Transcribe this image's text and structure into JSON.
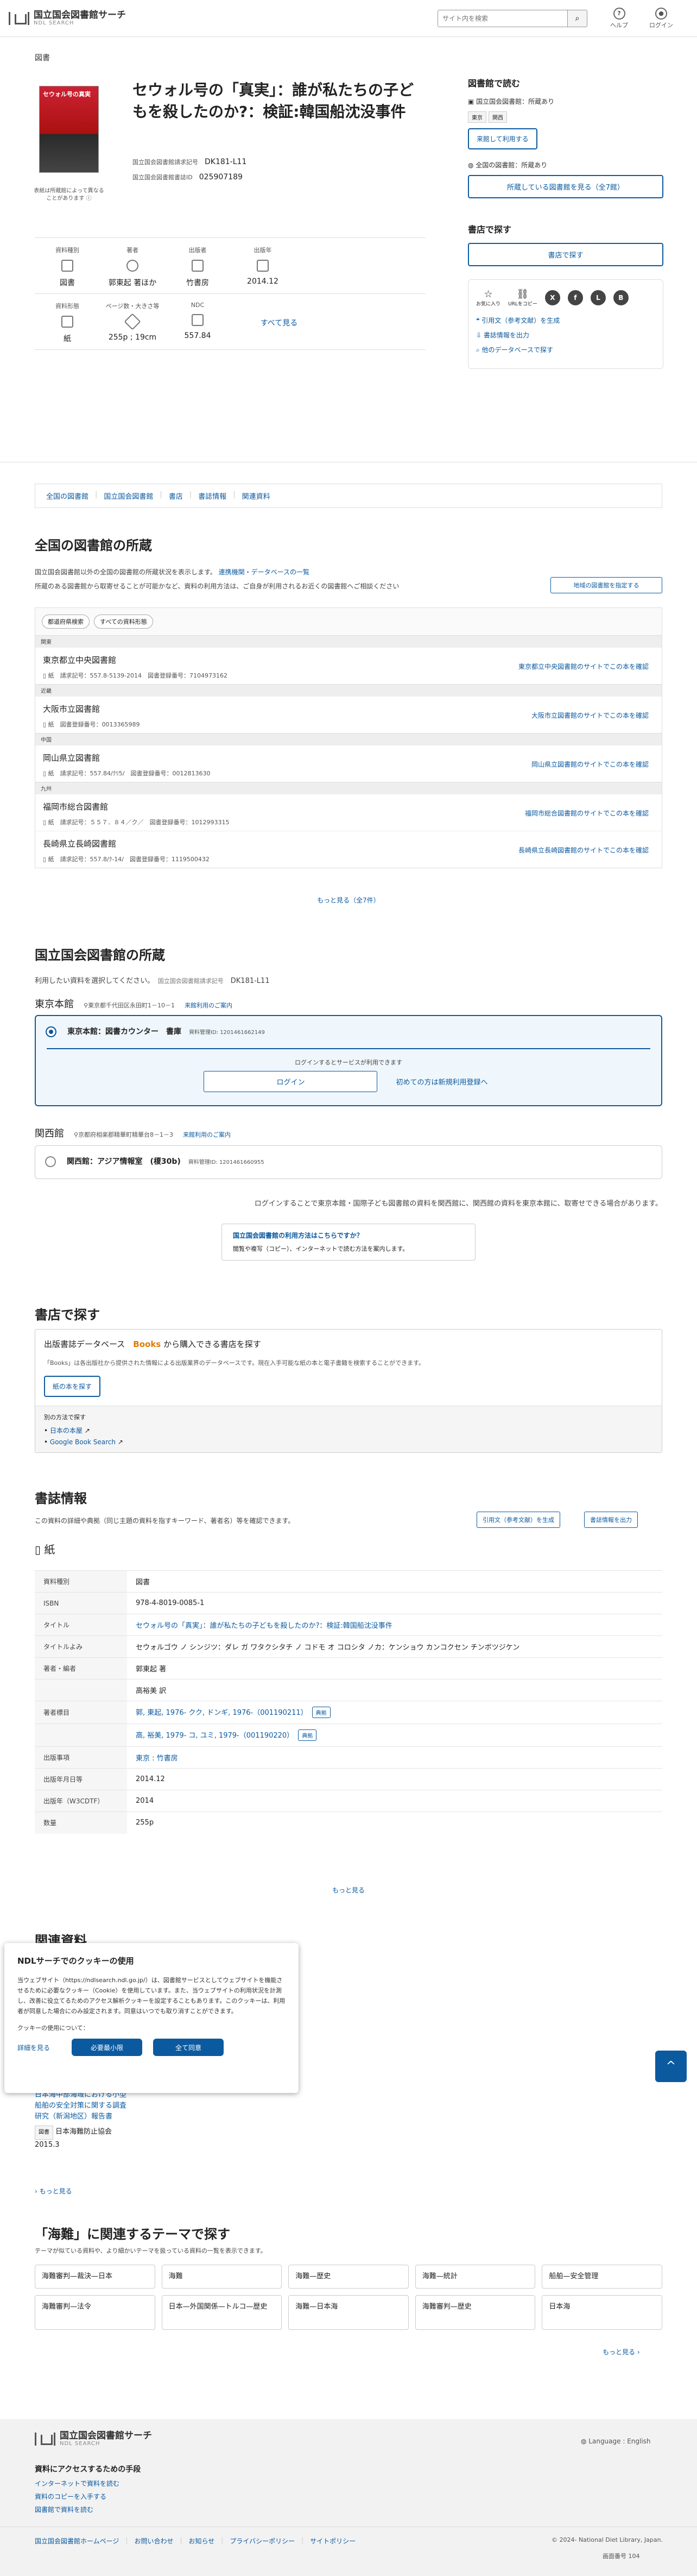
{
  "header": {
    "logo_title": "国立国会図書館サーチ",
    "logo_sub": "NDL SEARCH",
    "search_placeholder": "サイト内を検索",
    "help": "ヘルプ",
    "login": "ログイン"
  },
  "page_label": "図書",
  "book": {
    "title": "セウォル号の「真実」：誰が私たちの子どもを殺したのか?：検証:韓国船沈没事件",
    "cover_title": "セウォル号の真実",
    "cover_note": "表紙は所蔵館によって異なることがあります",
    "call_label": "国立国会図書館請求記号",
    "call_no": "DK181-L11",
    "bib_label": "国立国会図書館書誌ID",
    "bib_id": "025907189"
  },
  "meta": [
    {
      "label": "資料種別",
      "value": "図書"
    },
    {
      "label": "著者",
      "value": "郭東起 著ほか"
    },
    {
      "label": "出版者",
      "value": "竹書房"
    },
    {
      "label": "出版年",
      "value": "2014.12"
    },
    {
      "label": "資料形態",
      "value": "紙"
    },
    {
      "label": "ページ数・大きさ等",
      "value": "255p ; 19cm"
    },
    {
      "label": "NDC",
      "value": "557.84"
    }
  ],
  "meta_more": "すべて見る",
  "side": {
    "read_title": "図書館で読む",
    "ndl_owned": "国立国会図書館：所蔵あり",
    "tag1": "東京",
    "tag2": "関西",
    "visit_btn": "来館して利用する",
    "all_owned": "全国の図書館：所蔵あり",
    "all_btn": "所蔵している図書館を見る（全7館）",
    "shop_title": "書店で探す",
    "shop_btn": "書店で探す",
    "share_label1": "お気に入り",
    "share_label2": "URLをコピー",
    "cite": "引用文（参考文献）を生成",
    "export": "書誌情報を出力",
    "other_db": "他のデータベースで探す"
  },
  "tabs": [
    "全国の図書館",
    "国立国会図書館",
    "書店",
    "書誌情報",
    "関連資料"
  ],
  "national": {
    "heading": "全国の図書館の所蔵",
    "desc1": "国立国会図書館以外の全国の図書館の所蔵状況を表示します。",
    "db_link": "連携機関・データベースの一覧",
    "desc2": "所蔵のある図書館から取寄せることが可能かなど、資料の利用方法は、ご自身が利用されるお近くの図書館へご相談ください",
    "region_btn": "地域の図書館を指定する",
    "filter1": "都道府県検索",
    "filter2": "すべての資料形態",
    "libs": [
      {
        "region": "関東",
        "name": "東京都立中央図書館",
        "req": "請求記号：557.8-5139-2014",
        "reg": "図書登録番号：7104973162",
        "go": "東京都立中央図書館のサイトでこの本を確認"
      },
      {
        "region": "近畿",
        "name": "大阪市立図書館",
        "req": "",
        "reg": "図書登録番号：0013365989",
        "go": "大阪市立図書館のサイトでこの本を確認"
      },
      {
        "region": "中国",
        "name": "岡山県立図書館",
        "req": "請求記号：557.84/ｸﾘ5/",
        "reg": "図書登録番号：0012813630",
        "go": "岡山県立図書館のサイトでこの本を確認"
      },
      {
        "region": "九州",
        "name": "福岡市総合図書館",
        "req": "請求記号：５５７．８４／ク／",
        "reg": "図書登録番号：1012993315",
        "go": "福岡市総合図書館のサイトでこの本を確認"
      },
      {
        "region": "",
        "name": "長崎県立長崎図書館",
        "req": "請求記号：557.8/ｸ-14/",
        "reg": "図書登録番号：1119500432",
        "go": "長崎県立長崎図書館のサイトでこの本を確認"
      }
    ],
    "more": "もっと見る（全7件）",
    "paper": "紙"
  },
  "ndl": {
    "heading": "国立国会図書館の所蔵",
    "desc": "利用したい資料を選択してください。",
    "call_label": "国立国会図書館請求記号",
    "call_no": "DK181-L11",
    "tokyo": "東京本館",
    "tokyo_addr": "東京都千代田区永田町1－10－1",
    "tokyo_guide": "来館利用のご案内",
    "tokyo_loc": "東京本館：図書カウンター　書庫",
    "tokyo_id": "資料管理ID: 1201461662149",
    "login_text": "ログインするとサービスが利用できます",
    "login_btn": "ログイン",
    "register": "初めての方は新規利用登録へ",
    "kansai": "関西館",
    "kansai_addr": "京都府相楽郡精華町精華台8－1－3",
    "kansai_guide": "来館利用のご案内",
    "kansai_loc": "関西館：アジア情報室　(榎30b)",
    "kansai_id": "資料管理ID: 1201461660955",
    "note": "ログインすることで東京本館・国際子ども図書館の資料を関西館に、関西館の資料を東京本館に、取寄せできる場合があります。",
    "info_title": "国立国会図書館の利用方法はこちらですか？",
    "info_sub": "閲覧や複写（コピー）、インターネットで読む方法を案内します。"
  },
  "shop": {
    "heading": "書店で探す",
    "db_title": "出版書誌データベース",
    "books_logo": "Books",
    "books_suffix": "から購入できる書店を探す",
    "desc": "「Books」は各出版社から提供された情報による出版業界のデータベースです。現在入手可能な紙の本と電子書籍を検索することができます。",
    "paper_btn": "紙の本を探す",
    "other": "別の方法で探す",
    "amazon": "日本の本屋",
    "google": "Google Book Search"
  },
  "biblio": {
    "heading": "書誌情報",
    "desc": "この資料の詳細や典拠（同じ主題の資料を指すキーワード、著者名）等を確認できます。",
    "cite": "引用文（参考文献）を生成",
    "export": "書誌情報を出力",
    "paper": "紙",
    "rows": [
      {
        "k": "資料種別",
        "v": "図書"
      },
      {
        "k": "ISBN",
        "v": "978-4-8019-0085-1"
      },
      {
        "k": "タイトル",
        "v": "セウォル号の「真実」：誰が私たちの子どもを殺したのか?：検証:韓国船沈没事件"
      },
      {
        "k": "タイトルよみ",
        "v": "セウォルゴウ ノ シンジツ：ダレ ガ ワタクシタチ ノ コドモ オ コロシタ ノカ：ケンショウ カンコクセン チンボツジケン"
      },
      {
        "k": "著者・編者",
        "v": "郭東起 著"
      },
      {
        "k": "",
        "v": "高裕美 訳"
      },
      {
        "k": "著者標目",
        "v": "郭, 東起, 1976- クク, ドンギ, 1976-（001190211）"
      },
      {
        "k": "",
        "v": "高, 裕美, 1979- コ, ユミ, 1979-（001190220）"
      },
      {
        "k": "出版事項",
        "v": "東京 : 竹書房"
      },
      {
        "k": "出版年月日等",
        "v": "2014.12"
      },
      {
        "k": "出版年（W3CDTF）",
        "v": "2014"
      },
      {
        "k": "数量",
        "v": "255p"
      }
    ],
    "more": "もっと見る",
    "tentei": "典拠"
  },
  "related": {
    "heading": "関連資料",
    "item_title": "日本海中部海域における小型船舶の安全対策に関する調査研究（新潟地区）報告書",
    "item_tag": "図書",
    "item_pub": "日本海難防止協会　2015.3",
    "more": "もっと見る"
  },
  "cookie": {
    "title": "NDLサーチでのクッキーの使用",
    "body": "当ウェブサイト（https://ndlsearch.ndl.go.jp/）は、図書館サービスとしてウェブサイトを機能させるために必要なクッキー（Cookie）を使用しています。また、当ウェブサイトの利用状況を計測し、改善に役立てるためのアクセス解析クッキーを設定することもあります。このクッキーは、利用者が同意した場合にのみ設定されます。同意はいつでも取り消すことができます。",
    "usage": "クッキーの使用について：",
    "detail": "詳細を見る",
    "necessary": "必要最小限",
    "accept": "全て同意"
  },
  "themes": {
    "heading": "「海難」に関連するテーマで探す",
    "desc": "テーマが似ている資料や、より細かいテーマを扱っている資料の一覧を表示できます。",
    "items": [
      "海難審判—裁決—日本",
      "海難",
      "海難—歴史",
      "海難—統計",
      "船舶—安全管理",
      "海難審判—法令",
      "日本—外国関係—トルコ—歴史",
      "海難—日本海",
      "海難審判—歴史",
      "日本海"
    ],
    "more": "もっと見る"
  },
  "footer": {
    "logo_title": "国立国会図書館サーチ",
    "logo_sub": "NDL SEARCH",
    "lang": "Language : English",
    "access_title": "資料にアクセスするための手段",
    "l1": "インターネットで資料を読む",
    "l2": "資料のコピーを入手する",
    "l3": "図書館で資料を読む",
    "links": [
      "国立国会図書館ホームページ",
      "お問い合わせ",
      "お知らせ",
      "プライバシーポリシー",
      "サイトポリシー"
    ],
    "copy": "© 2024- National Diet Library, Japan.",
    "version": "画面番号 104"
  }
}
